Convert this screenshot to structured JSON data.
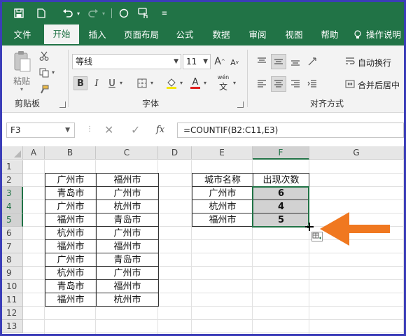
{
  "quick_access": {
    "icons": [
      "save-icon",
      "new-file-icon",
      "undo-icon",
      "redo-icon",
      "circle-shape-icon",
      "touch-mode-icon",
      "customize-icon"
    ]
  },
  "tabs": [
    "文件",
    "开始",
    "插入",
    "页面布局",
    "公式",
    "数据",
    "审阅",
    "视图",
    "帮助",
    "操作说明"
  ],
  "active_tab": "开始",
  "ribbon": {
    "clipboard": {
      "paste_label": "粘贴",
      "group_label": "剪贴板"
    },
    "font": {
      "font_name": "等线",
      "font_size": "11",
      "bold": "B",
      "italic": "I",
      "underline": "U",
      "grow": "A",
      "shrink": "A",
      "font_color_letter": "A",
      "phonetic": "wén",
      "group_label": "字体"
    },
    "alignment": {
      "wrap_text": "自动换行",
      "merge_center": "合并后居中",
      "group_label": "对齐方式"
    }
  },
  "formula_bar": {
    "name_box": "F3",
    "fx": "fx",
    "formula": "=COUNTIF(B2:C11,E3)"
  },
  "columns": [
    "A",
    "B",
    "C",
    "D",
    "E",
    "F",
    "G"
  ],
  "selected_column": "F",
  "rows": [
    "1",
    "2",
    "3",
    "4",
    "5",
    "6",
    "7",
    "8",
    "9",
    "10",
    "11",
    "12",
    "13"
  ],
  "selected_rows": [
    "3",
    "4",
    "5"
  ],
  "table_bc": [
    [
      "广州市",
      "福州市"
    ],
    [
      "青岛市",
      "广州市"
    ],
    [
      "广州市",
      "杭州市"
    ],
    [
      "福州市",
      "青岛市"
    ],
    [
      "杭州市",
      "广州市"
    ],
    [
      "福州市",
      "福州市"
    ],
    [
      "广州市",
      "青岛市"
    ],
    [
      "杭州市",
      "广州市"
    ],
    [
      "青岛市",
      "福州市"
    ],
    [
      "福州市",
      "杭州市"
    ]
  ],
  "table_ef": {
    "headers": [
      "城市名称",
      "出现次数"
    ],
    "rows": [
      [
        "广州市",
        "6"
      ],
      [
        "杭州市",
        "4"
      ],
      [
        "福州市",
        "5"
      ]
    ]
  },
  "colors": {
    "excel_green": "#217346",
    "frame": "#3b3db8",
    "arrow": "#f07820",
    "selection_fill": "#d2d2d2"
  }
}
